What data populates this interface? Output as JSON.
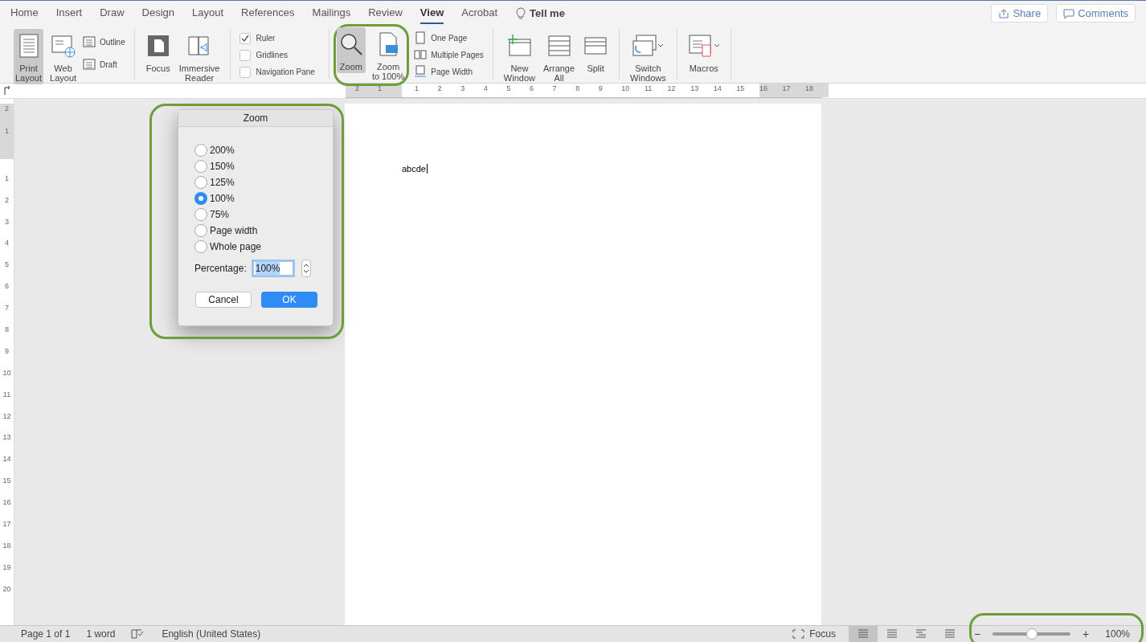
{
  "tabs": [
    {
      "label": "Home",
      "selected": false
    },
    {
      "label": "Insert",
      "selected": false
    },
    {
      "label": "Draw",
      "selected": false
    },
    {
      "label": "Design",
      "selected": false
    },
    {
      "label": "Layout",
      "selected": false
    },
    {
      "label": "References",
      "selected": false
    },
    {
      "label": "Mailings",
      "selected": false
    },
    {
      "label": "Review",
      "selected": false
    },
    {
      "label": "View",
      "selected": true
    },
    {
      "label": "Acrobat",
      "selected": false
    }
  ],
  "tell_me": "Tell me",
  "share": "Share",
  "comments": "Comments",
  "ribbon": [
    {
      "big": [
        {
          "label": [
            "Print",
            "Layout"
          ],
          "selected": true
        },
        {
          "label": [
            "Web",
            "Layout"
          ],
          "selected": false
        }
      ],
      "small": [
        "Outline",
        "Draft"
      ]
    },
    {
      "big": [
        {
          "label": [
            "Focus"
          ],
          "selected": false
        },
        {
          "label": [
            "Immersive",
            "Reader"
          ],
          "selected": false
        }
      ]
    },
    {
      "checks": [
        {
          "label": "Ruler",
          "checked": true
        },
        {
          "label": "Gridlines",
          "checked": false
        },
        {
          "label": "Navigation Pane",
          "checked": false
        }
      ]
    },
    {
      "big": [
        {
          "label": [
            "Zoom"
          ],
          "selected": true
        },
        {
          "label": [
            "Zoom",
            "to 100%"
          ],
          "selected": false
        }
      ],
      "small": [
        "One Page",
        "Multiple Pages",
        "Page Width"
      ]
    },
    {
      "big": [
        {
          "label": [
            "New",
            "Window"
          ],
          "selected": false
        },
        {
          "label": [
            "Arrange",
            "All"
          ],
          "selected": false
        },
        {
          "label": [
            "Split"
          ],
          "selected": false
        }
      ]
    },
    {
      "big": [
        {
          "label": [
            "Switch",
            "Windows"
          ],
          "selected": false,
          "dropdown": true
        }
      ]
    },
    {
      "big": [
        {
          "label": [
            "Macros"
          ],
          "selected": false,
          "dropdown": true
        }
      ]
    }
  ],
  "ruler_h": {
    "before": [
      "2",
      "1"
    ],
    "after": [
      "1",
      "2",
      "3",
      "4",
      "5",
      "6",
      "7",
      "8",
      "9",
      "10",
      "11",
      "12",
      "13",
      "14",
      "15",
      "16",
      "17",
      "18"
    ]
  },
  "ruler_v": {
    "before": [
      "2",
      "1"
    ],
    "after": [
      "1",
      "2",
      "3",
      "4",
      "5",
      "6",
      "7",
      "8",
      "9",
      "10",
      "11",
      "12",
      "13",
      "14",
      "15",
      "16",
      "17",
      "18",
      "19",
      "20"
    ]
  },
  "document": {
    "text": "abcde"
  },
  "dialog": {
    "title": "Zoom",
    "options": [
      {
        "label": "200%",
        "selected": false
      },
      {
        "label": "150%",
        "selected": false
      },
      {
        "label": "125%",
        "selected": false
      },
      {
        "label": "100%",
        "selected": true
      },
      {
        "label": "75%",
        "selected": false
      },
      {
        "label": "Page width",
        "selected": false
      },
      {
        "label": "Whole page",
        "selected": false
      }
    ],
    "percentage_label": "Percentage:",
    "percentage_value": "100%",
    "cancel": "Cancel",
    "ok": "OK"
  },
  "status_bar": {
    "page": "Page 1 of 1",
    "words": "1 word",
    "language": "English (United States)",
    "focus": "Focus",
    "views": [
      {
        "selected": true
      },
      {
        "selected": false
      },
      {
        "selected": false
      },
      {
        "selected": false
      }
    ],
    "zoom": {
      "minus": "−",
      "plus": "+",
      "level": 0.5,
      "reading": "100%"
    }
  }
}
